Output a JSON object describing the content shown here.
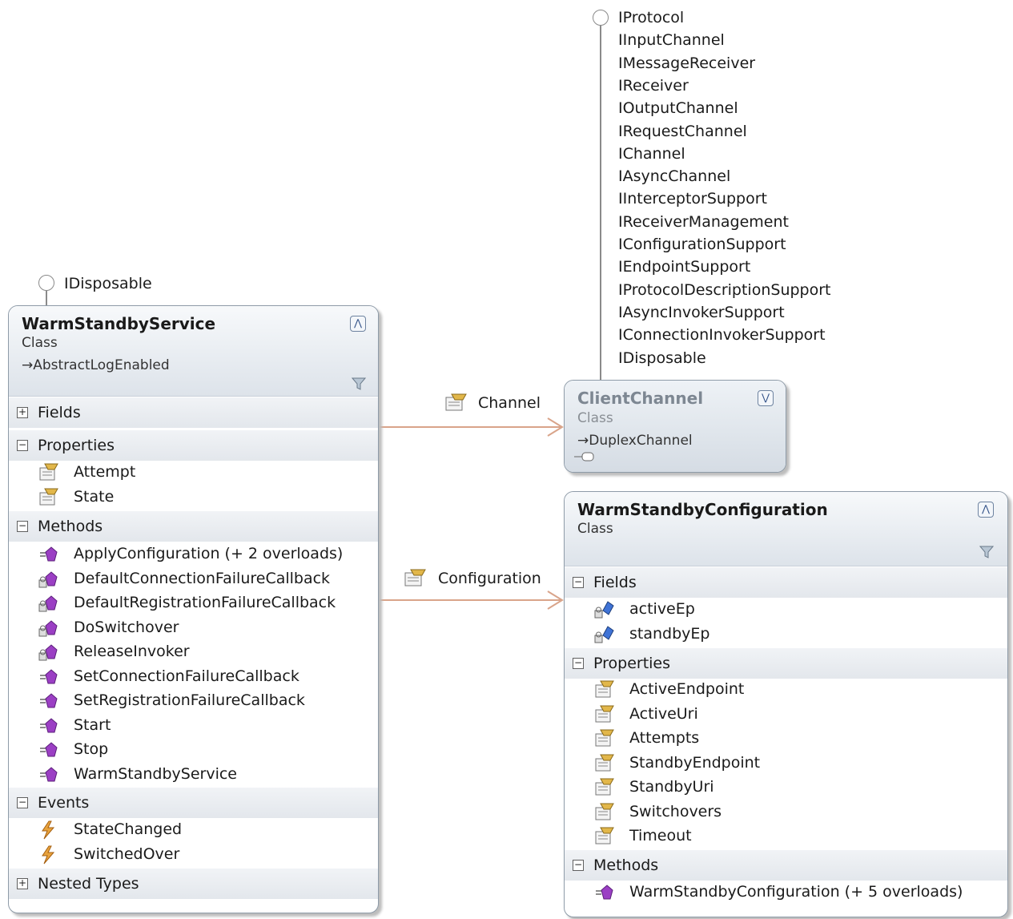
{
  "client_channel": {
    "interfaces": [
      "IProtocol",
      "IInputChannel",
      "IMessageReceiver",
      "IReceiver",
      "IOutputChannel",
      "IRequestChannel",
      "IChannel",
      "IAsyncChannel",
      "IInterceptorSupport",
      "IReceiverManagement",
      "IConfigurationSupport",
      "IEndpointSupport",
      "IProtocolDescriptionSupport",
      "IAsyncInvokerSupport",
      "IConnectionInvokerSupport",
      "IDisposable"
    ],
    "name": "ClientChannel",
    "kind": "Class",
    "base": "DuplexChannel"
  },
  "warm_service": {
    "interface": "IDisposable",
    "name": "WarmStandbyService",
    "kind": "Class",
    "base": "AbstractLogEnabled",
    "sections": {
      "fields": "Fields",
      "properties": "Properties",
      "methods": "Methods",
      "events": "Events",
      "nested": "Nested Types"
    },
    "properties": [
      "Attempt",
      "State"
    ],
    "methods": [
      "ApplyConfiguration (+ 2 overloads)",
      "DefaultConnectionFailureCallback",
      "DefaultRegistrationFailureCallback",
      "DoSwitchover",
      "ReleaseInvoker",
      "SetConnectionFailureCallback",
      "SetRegistrationFailureCallback",
      "Start",
      "Stop",
      "WarmStandbyService"
    ],
    "events": [
      "StateChanged",
      "SwitchedOver"
    ]
  },
  "warm_config": {
    "name": "WarmStandbyConfiguration",
    "kind": "Class",
    "sections": {
      "fields": "Fields",
      "properties": "Properties",
      "methods": "Methods"
    },
    "fields": [
      "activeEp",
      "standbyEp"
    ],
    "properties": [
      "ActiveEndpoint",
      "ActiveUri",
      "Attempts",
      "StandbyEndpoint",
      "StandbyUri",
      "Switchovers",
      "Timeout"
    ],
    "methods": [
      "WarmStandbyConfiguration (+ 5 overloads)"
    ]
  },
  "associations": {
    "channel": "Channel",
    "configuration": "Configuration"
  },
  "colors": {
    "connector": "#d9a48a",
    "method_icon": "#9b3fc4",
    "property_icon": "#e2b74a",
    "field_icon": "#3f73d6",
    "event_icon": "#e8a33d"
  },
  "icons": {
    "property": "property-icon",
    "method": "method-icon",
    "field": "field-icon",
    "event": "event-icon"
  }
}
